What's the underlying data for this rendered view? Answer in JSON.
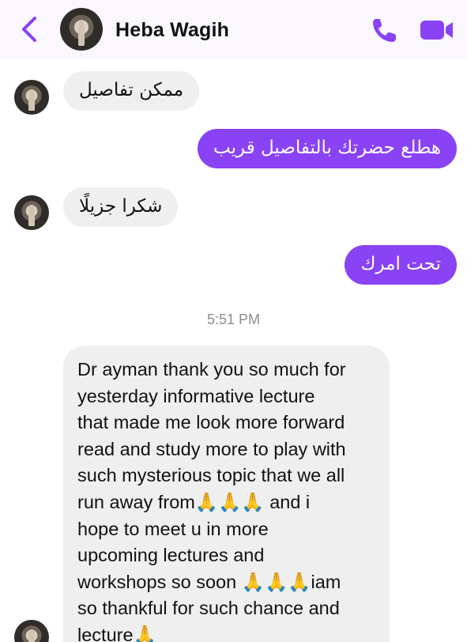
{
  "header": {
    "contact_name": "Heba Wagih"
  },
  "icons": {
    "back": "chevron-left-icon",
    "call": "phone-icon",
    "video": "video-camera-icon",
    "accent_color": "#8a42f5"
  },
  "messages": [
    {
      "direction": "incoming",
      "text": "ممكن تفاصيل"
    },
    {
      "direction": "outgoing",
      "text": "هطلع حضرتك بالتفاصيل قريب"
    },
    {
      "direction": "incoming",
      "text": "شكرا جزيلًا"
    },
    {
      "direction": "outgoing",
      "text": "تحت امرك"
    }
  ],
  "timestamp": "5:51 PM",
  "long_message": {
    "direction": "incoming",
    "lines": [
      "Dr ayman thank you so much for",
      "yesterday informative lecture",
      "that made me look more forward",
      "read and study more to play with",
      "such mysterious topic that we all",
      "run away from🙏🙏🙏 and i",
      "hope to meet u in more",
      "upcoming lectures and",
      "workshops so soon 🙏🙏🙏iam",
      "so thankful for such chance and",
      "lecture🙏"
    ]
  }
}
